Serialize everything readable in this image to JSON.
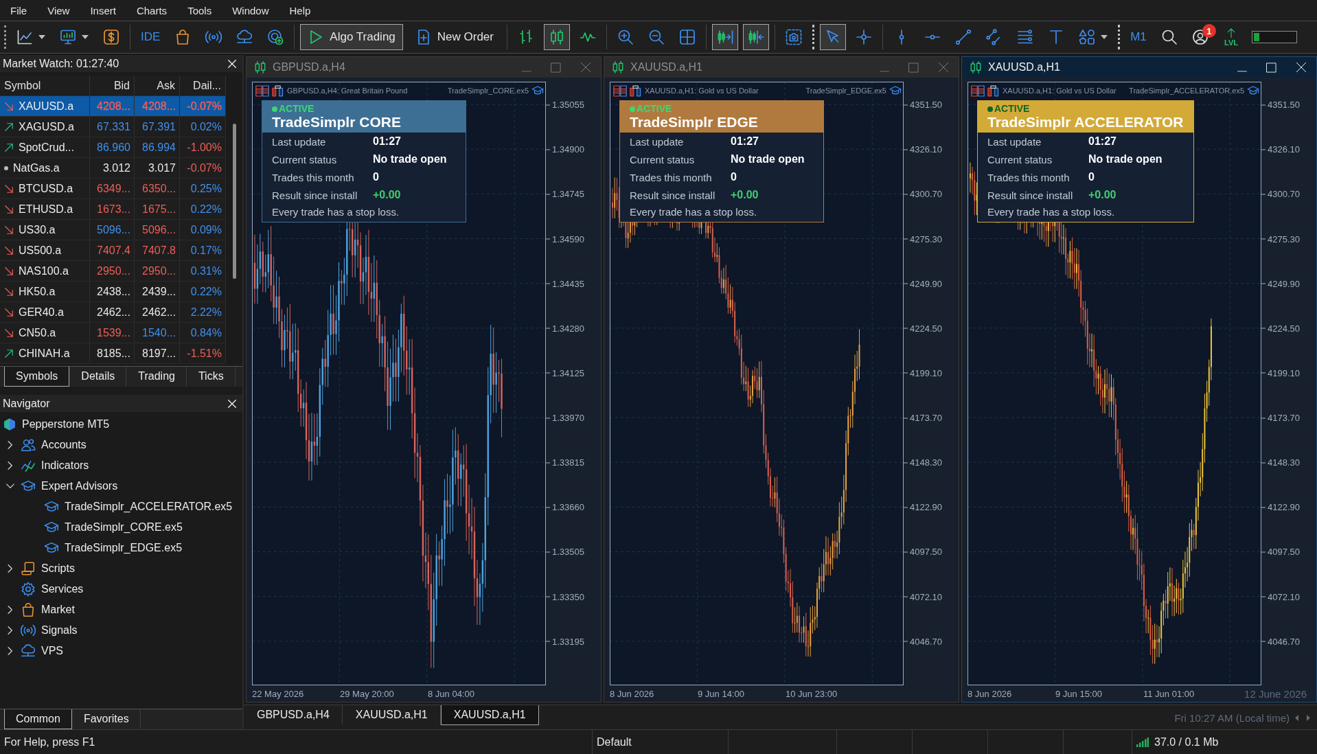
{
  "menu": [
    "File",
    "View",
    "Insert",
    "Charts",
    "Tools",
    "Window",
    "Help"
  ],
  "toolbar": {
    "groups": [
      {
        "items": [
          {
            "kind": "menu_icon",
            "pressed": false
          },
          {
            "kind": "menu_icon",
            "pressed": false
          },
          {
            "kind": "icon",
            "pressed": false
          }
        ]
      },
      {
        "items": [
          {
            "kind": "text",
            "label": "IDE",
            "pressed": false
          },
          {
            "kind": "icon",
            "pressed": false
          },
          {
            "kind": "icon",
            "pressed": false
          },
          {
            "kind": "icon",
            "pressed": false
          },
          {
            "kind": "icon",
            "pressed": false
          }
        ]
      },
      {
        "items": [
          {
            "kind": "labeled",
            "label": "Algo Trading",
            "pressed": true
          },
          {
            "kind": "labeled",
            "label": "New Order",
            "pressed": false
          }
        ]
      },
      {
        "items": [
          {
            "kind": "icon",
            "pressed": false
          },
          {
            "kind": "icon",
            "pressed": true
          },
          {
            "kind": "icon",
            "pressed": false
          }
        ]
      },
      {
        "items": [
          {
            "kind": "icon",
            "pressed": false
          },
          {
            "kind": "icon",
            "pressed": false
          },
          {
            "kind": "icon",
            "pressed": false
          }
        ]
      },
      {
        "items": [
          {
            "kind": "icon",
            "pressed": true
          },
          {
            "kind": "icon",
            "pressed": true
          }
        ]
      },
      {
        "items": [
          {
            "kind": "icon",
            "pressed": false
          }
        ]
      },
      {
        "items": [
          {
            "kind": "icon",
            "pressed": true
          },
          {
            "kind": "icon",
            "pressed": false
          }
        ]
      },
      {
        "items": [
          {
            "kind": "icon",
            "pressed": false
          },
          {
            "kind": "icon",
            "pressed": false
          },
          {
            "kind": "icon",
            "pressed": false
          },
          {
            "kind": "icon",
            "pressed": false
          },
          {
            "kind": "icon",
            "pressed": false
          },
          {
            "kind": "icon",
            "pressed": false
          },
          {
            "kind": "menu_icon",
            "pressed": false
          }
        ]
      },
      {
        "items": [
          {
            "kind": "text",
            "label": "M1",
            "pressed": false
          },
          {
            "kind": "icon",
            "pressed": false
          },
          {
            "kind": "badge_icon",
            "badge": "1",
            "pressed": false
          },
          {
            "kind": "icon_label",
            "label": "LVL",
            "pressed": false
          },
          {
            "kind": "meter",
            "level": 0.14
          }
        ]
      }
    ]
  },
  "market_watch": {
    "title": "Market Watch: 01:27:40",
    "columns": [
      "Symbol",
      "Bid",
      "Ask",
      "Dail..."
    ],
    "rows": [
      {
        "symbol": "XAUUSD.a",
        "kind": "falling",
        "bid": {
          "text": "4208...",
          "color": "#ef5e58"
        },
        "ask": {
          "text": "4208...",
          "color": "#ef5e58"
        },
        "daily": {
          "text": "-0.07%",
          "color": "#ef5e58"
        },
        "selected": true
      },
      {
        "symbol": "XAGUSD.a",
        "kind": "rising",
        "bid": {
          "text": "67.331",
          "color": "#3f90f0"
        },
        "ask": {
          "text": "67.391",
          "color": "#3f90f0"
        },
        "daily": {
          "text": "0.02%",
          "color": "#3f90f0"
        },
        "selected": false
      },
      {
        "symbol": "SpotCrud...",
        "kind": "rising",
        "bid": {
          "text": "86.960",
          "color": "#3f90f0"
        },
        "ask": {
          "text": "86.994",
          "color": "#3f90f0"
        },
        "daily": {
          "text": "-1.00%",
          "color": "#ef5e58"
        },
        "selected": false
      },
      {
        "symbol": "NatGas.a",
        "kind": "flat",
        "bid": {
          "text": "3.012",
          "color": "#e8e8e8"
        },
        "ask": {
          "text": "3.017",
          "color": "#e8e8e8"
        },
        "daily": {
          "text": "-0.07%",
          "color": "#ef5e58"
        },
        "selected": false
      },
      {
        "symbol": "BTCUSD.a",
        "kind": "falling",
        "bid": {
          "text": "6349...",
          "color": "#ef5e58"
        },
        "ask": {
          "text": "6350...",
          "color": "#ef5e58"
        },
        "daily": {
          "text": "0.25%",
          "color": "#3f90f0"
        },
        "selected": false
      },
      {
        "symbol": "ETHUSD.a",
        "kind": "falling",
        "bid": {
          "text": "1673...",
          "color": "#ef5e58"
        },
        "ask": {
          "text": "1675...",
          "color": "#ef5e58"
        },
        "daily": {
          "text": "0.22%",
          "color": "#3f90f0"
        },
        "selected": false
      },
      {
        "symbol": "US30.a",
        "kind": "falling",
        "bid": {
          "text": "5096...",
          "color": "#3f90f0"
        },
        "ask": {
          "text": "5096...",
          "color": "#ef5e58"
        },
        "daily": {
          "text": "0.09%",
          "color": "#3f90f0"
        },
        "selected": false
      },
      {
        "symbol": "US500.a",
        "kind": "falling",
        "bid": {
          "text": "7407.4",
          "color": "#ef5e58"
        },
        "ask": {
          "text": "7407.8",
          "color": "#ef5e58"
        },
        "daily": {
          "text": "0.17%",
          "color": "#3f90f0"
        },
        "selected": false
      },
      {
        "symbol": "NAS100.a",
        "kind": "falling",
        "bid": {
          "text": "2950...",
          "color": "#ef5e58"
        },
        "ask": {
          "text": "2950...",
          "color": "#ef5e58"
        },
        "daily": {
          "text": "0.31%",
          "color": "#3f90f0"
        },
        "selected": false
      },
      {
        "symbol": "HK50.a",
        "kind": "falling",
        "bid": {
          "text": "2438...",
          "color": "#e8e8e8"
        },
        "ask": {
          "text": "2439...",
          "color": "#e8e8e8"
        },
        "daily": {
          "text": "0.22%",
          "color": "#3f90f0"
        },
        "selected": false
      },
      {
        "symbol": "GER40.a",
        "kind": "falling",
        "bid": {
          "text": "2462...",
          "color": "#e8e8e8"
        },
        "ask": {
          "text": "2462...",
          "color": "#e8e8e8"
        },
        "daily": {
          "text": "2.22%",
          "color": "#3f90f0"
        },
        "selected": false
      },
      {
        "symbol": "CN50.a",
        "kind": "falling",
        "bid": {
          "text": "1539...",
          "color": "#ef5e58"
        },
        "ask": {
          "text": "1540...",
          "color": "#3f90f0"
        },
        "daily": {
          "text": "0.84%",
          "color": "#3f90f0"
        },
        "selected": false
      },
      {
        "symbol": "CHINAH.a",
        "kind": "rising",
        "bid": {
          "text": "8185...",
          "color": "#e8e8e8"
        },
        "ask": {
          "text": "8197...",
          "color": "#e8e8e8"
        },
        "daily": {
          "text": "-1.51%",
          "color": "#ef5e58"
        },
        "selected": false
      }
    ],
    "tabs": [
      {
        "label": "Symbols",
        "selected": true
      },
      {
        "label": "Details",
        "selected": false
      },
      {
        "label": "Trading",
        "selected": false
      },
      {
        "label": "Ticks",
        "selected": false
      }
    ]
  },
  "navigator": {
    "title": "Navigator",
    "tree": [
      {
        "label": "Pepperstone MT5",
        "kind": "root",
        "children": [
          {
            "label": "Accounts",
            "kind": "folder",
            "expanded": false
          },
          {
            "label": "Indicators",
            "kind": "folder",
            "expanded": false
          },
          {
            "label": "Expert Advisors",
            "kind": "folder",
            "expanded": true,
            "children": [
              {
                "label": "TradeSimplr_ACCELERATOR.ex5"
              },
              {
                "label": "TradeSimplr_CORE.ex5"
              },
              {
                "label": "TradeSimplr_EDGE.ex5"
              }
            ]
          },
          {
            "label": "Scripts",
            "kind": "folder",
            "expanded": false
          },
          {
            "label": "Services",
            "kind": "leaf"
          },
          {
            "label": "Market",
            "kind": "folder",
            "expanded": false
          },
          {
            "label": "Signals",
            "kind": "folder",
            "expanded": false
          },
          {
            "label": "VPS",
            "kind": "folder",
            "expanded": false
          }
        ]
      }
    ],
    "tabs": [
      {
        "label": "Common",
        "selected": true
      },
      {
        "label": "Favorites",
        "selected": false
      }
    ]
  },
  "charts": [
    {
      "title": "GBPUSD.a,H4",
      "active": false,
      "description": "GBPUSD.a,H4:  Great Britain Pound",
      "expert": "TradeSimplr_CORE.ex5",
      "panel": {
        "color": "#3d6f95",
        "active": true,
        "status": "ACTIVE",
        "name": "TradeSimplr CORE",
        "rows": [
          {
            "label": "Last update",
            "value": "01:27",
            "kind": "plain"
          },
          {
            "label": "Current status",
            "value": "No trade open",
            "kind": "plain"
          },
          {
            "label": "Trades this month",
            "value": "0",
            "kind": "plain"
          },
          {
            "label": "Result since install",
            "value": "+0.00",
            "kind": "profit"
          }
        ],
        "note": "Every trade has a stop loss."
      },
      "price_ticks": [
        "1.35055",
        "1.34900",
        "1.34745",
        "1.34590",
        "1.34435",
        "1.34280",
        "1.34125",
        "1.33970",
        "1.33815",
        "1.33660",
        "1.33505",
        "1.33350",
        "1.33195"
      ],
      "time_ticks": [
        "22 May 2026",
        "29 May 20:00",
        "8 Jun 04:00"
      ]
    },
    {
      "title": "XAUUSD.a,H1",
      "active": false,
      "description": "XAUUSD.a,H1:  Gold vs US Dollar",
      "expert": "TradeSimplr_EDGE.ex5",
      "panel": {
        "color": "#b07a3f",
        "active": true,
        "status": "ACTIVE",
        "name": "TradeSimplr EDGE",
        "rows": [
          {
            "label": "Last update",
            "value": "01:27",
            "kind": "plain"
          },
          {
            "label": "Current status",
            "value": "No trade open",
            "kind": "plain"
          },
          {
            "label": "Trades this month",
            "value": "0",
            "kind": "plain"
          },
          {
            "label": "Result since install",
            "value": "+0.00",
            "kind": "profit"
          }
        ],
        "note": "Every trade has a stop loss."
      },
      "price_ticks": [
        "4351.50",
        "4326.10",
        "4300.70",
        "4275.30",
        "4249.90",
        "4224.50",
        "4199.10",
        "4173.70",
        "4148.30",
        "4122.90",
        "4097.50",
        "4072.10",
        "4046.70"
      ],
      "time_ticks": [
        "8 Jun 2026",
        "9 Jun 14:00",
        "10 Jun 23:00"
      ]
    },
    {
      "title": "XAUUSD.a,H1",
      "active": true,
      "description": "XAUUSD.a,H1:  Gold vs US Dollar",
      "expert": "TradeSimplr_ACCELERATOR.ex5",
      "panel": {
        "color": "#d3aa37",
        "active": true,
        "status": "ACTIVE",
        "name": "TradeSimplr ACCELERATOR",
        "rows": [
          {
            "label": "Last update",
            "value": "01:27",
            "kind": "plain"
          },
          {
            "label": "Current status",
            "value": "No trade open",
            "kind": "plain"
          },
          {
            "label": "Trades this month",
            "value": "0",
            "kind": "plain"
          },
          {
            "label": "Result since install",
            "value": "+0.00",
            "kind": "profit"
          }
        ],
        "note": "Every trade has a stop loss."
      },
      "price_ticks": [
        "4351.50",
        "4326.10",
        "4300.70",
        "4275.30",
        "4249.90",
        "4224.50",
        "4199.10",
        "4173.70",
        "4148.30",
        "4122.90",
        "4097.50",
        "4072.10",
        "4046.70"
      ],
      "time_ticks": [
        "8 Jun 2026",
        "9 Jun 15:00",
        "11 Jun 01:00"
      ],
      "date_note": "12 June 2026"
    }
  ],
  "chart_tabs": {
    "tabs": [
      {
        "label": "GBPUSD.a,H4",
        "selected": false
      },
      {
        "label": "XAUUSD.a,H1",
        "selected": false
      },
      {
        "label": "XAUUSD.a,H1",
        "selected": true
      }
    ],
    "note": "Fri 10:27 AM (Local time)"
  },
  "status_bar": {
    "help": "For Help, press F1",
    "profile": "Default",
    "traffic": "37.0 / 0.1 Mb"
  }
}
